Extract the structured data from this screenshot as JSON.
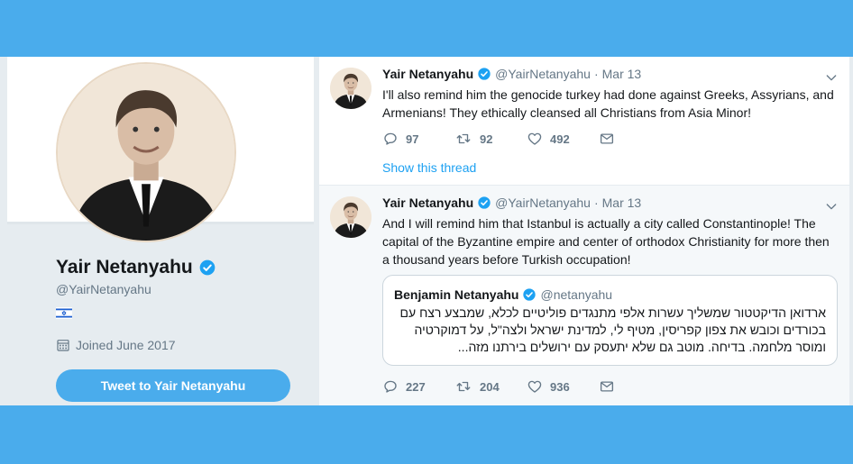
{
  "profile": {
    "name": "Yair Netanyahu",
    "handle": "@YairNetanyahu",
    "flag": "🇮🇱",
    "joined": "Joined June 2017",
    "tweet_to_label": "Tweet to Yair Netanyahu"
  },
  "tweets": [
    {
      "name": "Yair Netanyahu",
      "handle": "@YairNetanyahu",
      "dot": "·",
      "date": "Mar 13",
      "text": "I'll also remind him the genocide turkey had done against Greeks, Assyrians, and Armenians! They ethically cleansed all Christians from Asia Minor!",
      "replies": "97",
      "retweets": "92",
      "likes": "492",
      "thread_link": "Show this thread"
    },
    {
      "name": "Yair Netanyahu",
      "handle": "@YairNetanyahu",
      "dot": "·",
      "date": "Mar 13",
      "text": "And I will remind him that Istanbul is actually a city called Constantinople! The capital of the Byzantine empire and center of orthodox Christianity for more then a thousand years before Turkish occupation!",
      "replies": "227",
      "retweets": "204",
      "likes": "936",
      "quote": {
        "name": "Benjamin Netanyahu",
        "handle": "@netanyahu",
        "text": "ארדואן הדיקטטור שמשליך עשרות אלפי מתנגדים פוליטיים לכלא, שמבצע רצח עם בכורדים וכובש את צפון קפריסין, מטיף לי, למדינת ישראל ולצה\"ל, על דמוקרטיה ומוסר מלחמה. בדיחה. מוטב גם שלא יתעסק עם ירושלים בירתנו מזה..."
      }
    }
  ],
  "colors": {
    "brand": "#4aacec",
    "verified": "#1da1f2",
    "secondary_text": "#657786",
    "link": "#1da1f2"
  },
  "icons": {
    "verified": "verified-badge-icon",
    "calendar": "calendar-icon",
    "reply": "reply-icon",
    "retweet": "retweet-icon",
    "like": "heart-icon",
    "dm": "envelope-icon",
    "caret": "chevron-down-icon"
  }
}
